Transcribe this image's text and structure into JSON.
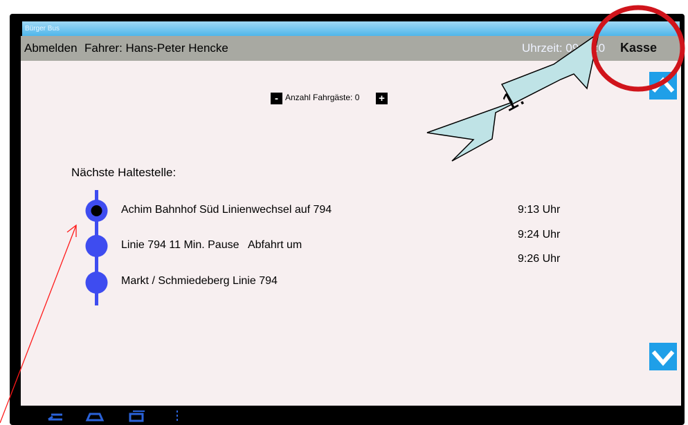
{
  "app": {
    "title": "Bürger Bus"
  },
  "header": {
    "logout_label": "Abmelden",
    "driver_label": "Fahrer: Hans-Peter Hencke",
    "time_label": "Uhrzeit: 09:13:",
    "time_tail": "0",
    "cash_label": "Kasse"
  },
  "passengers": {
    "minus_label": "-",
    "label": "Anzahl Fahrgäste: 0",
    "plus_label": "+"
  },
  "next_stop_label": "Nächste Haltestelle:",
  "stops": [
    {
      "name": "Achim Bahnhof Süd Linienwechsel auf 794",
      "time": "9:13 Uhr",
      "current": true
    },
    {
      "name": "Linie 794 11 Min. Pause   Abfahrt um",
      "time": "9:24 Uhr",
      "time2": "9:26 Uhr",
      "current": false
    },
    {
      "name": "Markt / Schmiedeberg Linie 794",
      "time": "",
      "current": false
    }
  ],
  "annotation": {
    "step_label": "1."
  },
  "colors": {
    "accent": "#1f9fe8",
    "stop_dot": "#3e4cf0",
    "header_bg": "#a8a9a2",
    "content_bg": "#f7eff0",
    "annotation_red": "#d0141b",
    "arrow_fill": "#bfe3e6"
  },
  "icons": [
    "scroll-up-icon",
    "scroll-down-icon",
    "back-icon",
    "home-icon",
    "recent-apps-icon",
    "menu-icon"
  ]
}
